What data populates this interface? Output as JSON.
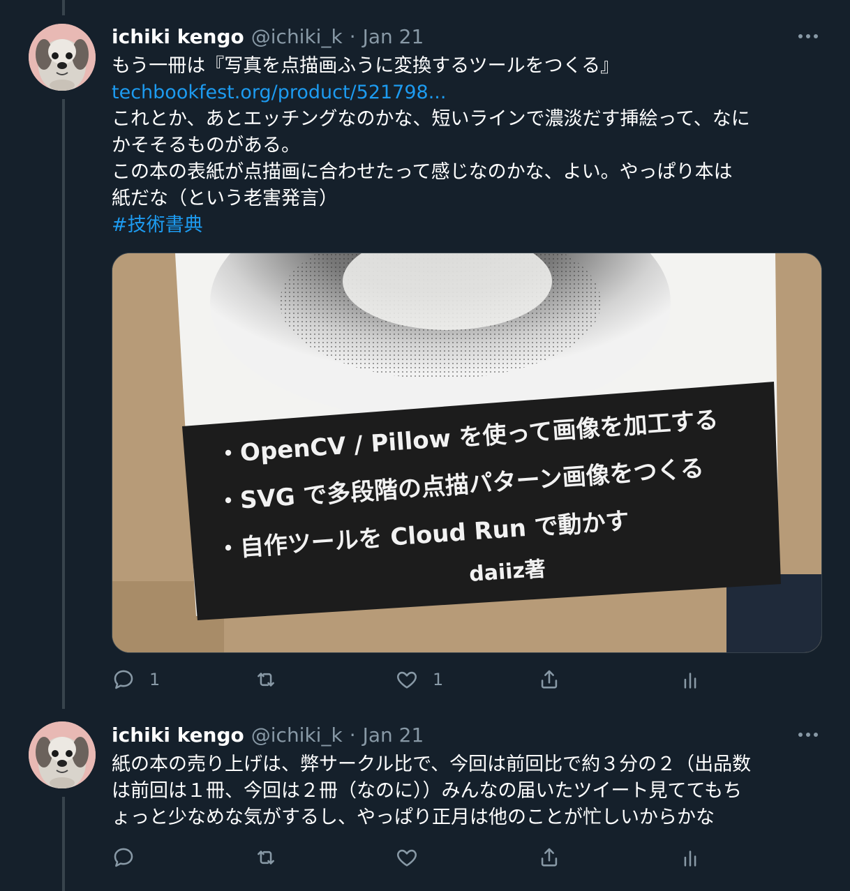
{
  "tweets": [
    {
      "author": {
        "name": "ichiki kengo",
        "handle": "@ichiki_k"
      },
      "dot": "·",
      "date": "Jan 21",
      "text": {
        "line1": "もう一冊は『写真を点描画ふうに変換するツールをつくる』",
        "link": "techbookfest.org/product/521798...",
        "line3": "これとか、あとエッチングなのかな、短いラインで濃淡だす挿絵って、なに",
        "line4": "かそそるものがある。",
        "line5": "この本の表紙が点描画に合わせたって感じなのかな、よい。やっぱり本は",
        "line6": "紙だな（という老害発言）",
        "hashtag": "#技術書典"
      },
      "media": {
        "bullet1": "・OpenCV / Pillow を使って画像を加工する",
        "bullet2": "・SVG で多段階の点描パターン画像をつくる",
        "bullet3": "・自作ツールを Cloud Run で動かす",
        "author": "daiiz著"
      },
      "actions": {
        "reply_count": "1",
        "retweet_count": "",
        "like_count": "1"
      }
    },
    {
      "author": {
        "name": "ichiki kengo",
        "handle": "@ichiki_k"
      },
      "dot": "·",
      "date": "Jan 21",
      "text": {
        "line1": "紙の本の売り上げは、弊サークル比で、今回は前回比で約３分の２（出品数",
        "line2": "は前回は１冊、今回は２冊（なのに））みんなの届いたツイート見ててもち",
        "line3": "ょっと少なめな気がするし、やっぱり正月は他のことが忙しいからかな"
      },
      "actions": {
        "reply_count": "",
        "retweet_count": "",
        "like_count": ""
      }
    }
  ],
  "colors": {
    "background": "#15202b",
    "link": "#1d9bf0",
    "muted": "#8899a6",
    "divider": "#38444d"
  }
}
